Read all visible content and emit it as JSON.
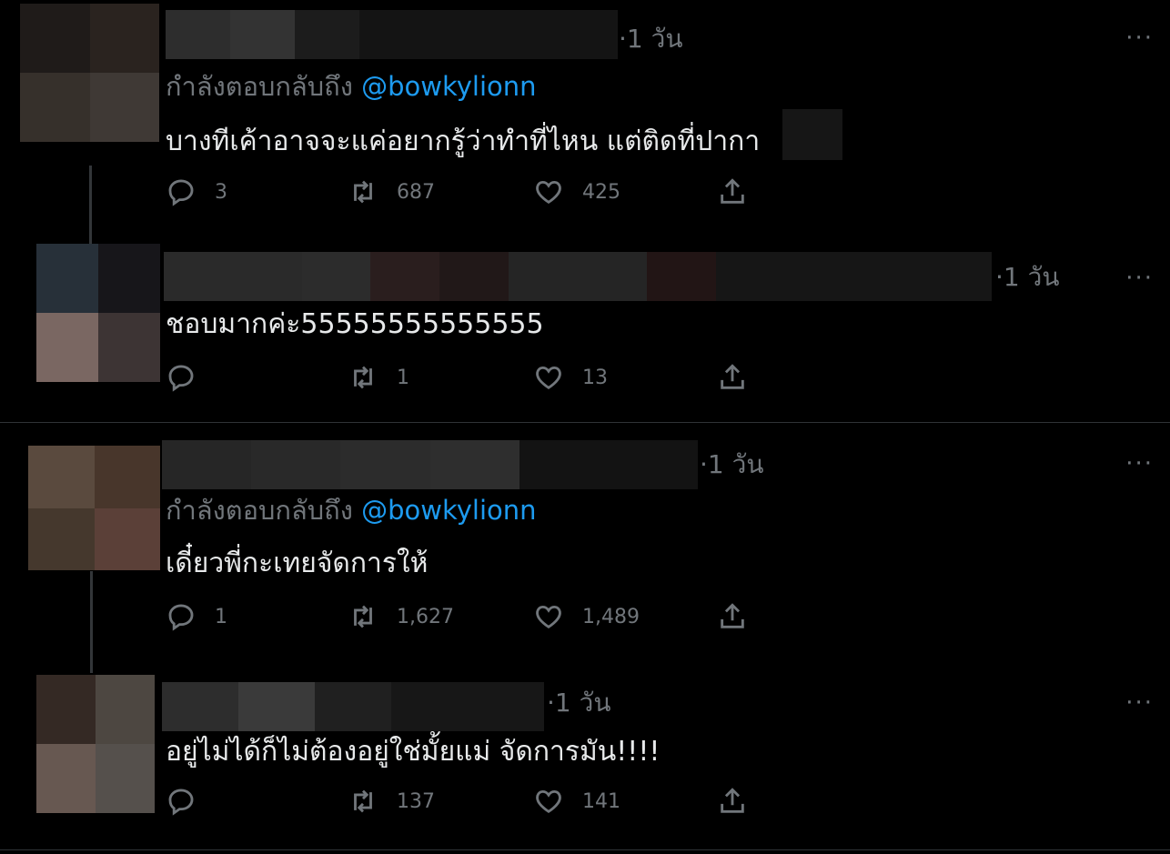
{
  "theme": {
    "background": "#000000",
    "text": "#e7e9ea",
    "muted": "#71767b",
    "link": "#1d9bf0",
    "divider": "#2f3336"
  },
  "icons": {
    "reply": "reply-icon",
    "retweet": "retweet-icon",
    "like": "heart-icon",
    "share": "share-icon",
    "more": "more-icon"
  },
  "tweets": [
    {
      "time": "·1 วัน",
      "reply_label": "กำลังตอบกลับถึง",
      "reply_handle": "@bowkylionn",
      "text": "บางทีเค้าอาจจะแค่อยากรู้ว่าทำที่ไหน แต่ติดที่ปากา",
      "replies": "3",
      "retweets": "687",
      "likes": "425",
      "more": "···"
    },
    {
      "time": "·1 วัน",
      "text": "ชอบมากค่ะ55555555555555",
      "replies": "",
      "retweets": "1",
      "likes": "13",
      "more": "···"
    },
    {
      "time": "·1 วัน",
      "reply_label": "กำลังตอบกลับถึง",
      "reply_handle": "@bowkylionn",
      "text": "เดี๋ยวพี่กะเทยจัดการให้",
      "replies": "1",
      "retweets": "1,627",
      "likes": "1,489",
      "more": "···"
    },
    {
      "time": "·1 วัน",
      "text": "อยู่ไม่ได้ก็ไม่ต้องอยู่ใช่มั้ยแม่ จัดการมัน!!!!",
      "replies": "",
      "retweets": "137",
      "likes": "141",
      "more": "···"
    }
  ]
}
